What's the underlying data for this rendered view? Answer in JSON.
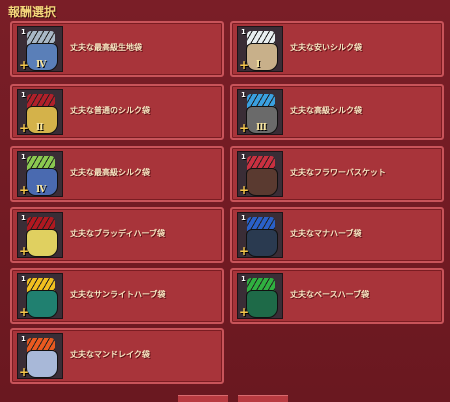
{
  "header": {
    "title": "報酬選択"
  },
  "rewards": [
    {
      "name": "丈夫な最高級生地袋",
      "qty": "1",
      "rank": "Ⅳ",
      "sack_color": "#5a7fb8",
      "content_color": "#a9b8c6",
      "icon": "fabric-bag-icon"
    },
    {
      "name": "丈夫な安いシルク袋",
      "qty": "1",
      "rank": "Ⅰ",
      "sack_color": "#c8b08a",
      "content_color": "#e8eef0",
      "icon": "silk-bag-icon"
    },
    {
      "name": "丈夫な普通のシルク袋",
      "qty": "1",
      "rank": "Ⅱ",
      "sack_color": "#d4b24a",
      "content_color": "#b0202a",
      "icon": "silk-bag-icon"
    },
    {
      "name": "丈夫な高級シルク袋",
      "qty": "1",
      "rank": "Ⅲ",
      "sack_color": "#6a6a6a",
      "content_color": "#3aa0e0",
      "icon": "silk-bag-icon"
    },
    {
      "name": "丈夫な最高級シルク袋",
      "qty": "1",
      "rank": "Ⅳ",
      "sack_color": "#4a6ab0",
      "content_color": "#8ac850",
      "icon": "silk-bag-icon"
    },
    {
      "name": "丈夫なフラワーバスケット",
      "qty": "1",
      "rank": "",
      "sack_color": "#5a3a30",
      "content_color": "#c83040",
      "icon": "flower-basket-icon"
    },
    {
      "name": "丈夫なブラッディハーブ袋",
      "qty": "1",
      "rank": "",
      "sack_color": "#e0d060",
      "content_color": "#b01820",
      "icon": "herb-bag-icon"
    },
    {
      "name": "丈夫なマナハーブ袋",
      "qty": "1",
      "rank": "",
      "sack_color": "#2a3a50",
      "content_color": "#2a60c8",
      "icon": "herb-bag-icon"
    },
    {
      "name": "丈夫なサンライトハーブ袋",
      "qty": "1",
      "rank": "",
      "sack_color": "#208070",
      "content_color": "#f0c020",
      "icon": "herb-bag-icon"
    },
    {
      "name": "丈夫なベースハーブ袋",
      "qty": "1",
      "rank": "",
      "sack_color": "#1e6a48",
      "content_color": "#30b040",
      "icon": "herb-bag-icon"
    },
    {
      "name": "丈夫なマンドレイク袋",
      "qty": "1",
      "rank": "",
      "sack_color": "#a8b8d8",
      "content_color": "#e85a20",
      "icon": "herb-bag-icon"
    }
  ]
}
